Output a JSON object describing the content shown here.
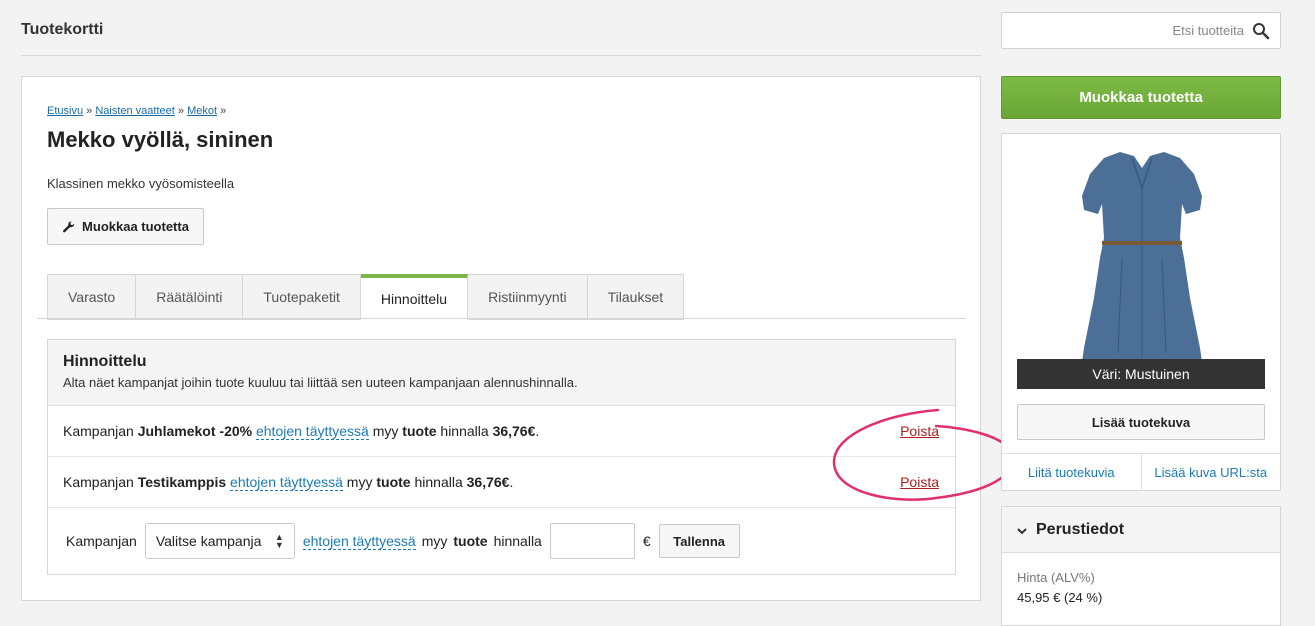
{
  "header": {
    "title": "Tuotekortti",
    "search_placeholder": "Etsi tuotteita"
  },
  "breadcrumb": {
    "items": [
      "Etusivu",
      "Naisten vaatteet",
      "Mekot"
    ],
    "separator": "»"
  },
  "product": {
    "title": "Mekko vyöllä, sininen",
    "description": "Klassinen mekko vyösomisteella",
    "edit_label": "Muokkaa tuotetta"
  },
  "tabs": [
    {
      "label": "Varasto"
    },
    {
      "label": "Räätälöinti"
    },
    {
      "label": "Tuotepaketit"
    },
    {
      "label": "Hinnoittelu",
      "active": true
    },
    {
      "label": "Ristiinmyynti"
    },
    {
      "label": "Tilaukset"
    }
  ],
  "pricing": {
    "title": "Hinnoittelu",
    "subtitle": "Alta näet kampanjat joihin tuote kuuluu tai liittää sen uuteen kampanjaan alennushinnalla.",
    "campaigns": [
      {
        "prefix": "Kampanjan",
        "name": "Juhlamekot -20%",
        "condition": "ehtojen täyttyessä",
        "sells": "myy",
        "object": "tuote",
        "at_price": "hinnalla",
        "price": "36,76€",
        "remove": "Poista"
      },
      {
        "prefix": "Kampanjan",
        "name": "Testikamppis",
        "condition": "ehtojen täyttyessä",
        "sells": "myy",
        "object": "tuote",
        "at_price": "hinnalla",
        "price": "36,76€",
        "remove": "Poista"
      }
    ],
    "new_row": {
      "prefix": "Kampanjan",
      "select_value": "Valitse kampanja",
      "condition": "ehtojen täyttyessä",
      "sells": "myy",
      "object": "tuote",
      "at_price": "hinnalla",
      "currency": "€",
      "save_label": "Tallenna"
    }
  },
  "sidebar": {
    "edit_label": "Muokkaa tuotetta",
    "color_label": "Väri: Mustuinen",
    "add_image_label": "Lisää tuotekuva",
    "attach_images_label": "Liitä tuotekuvia",
    "add_from_url_label": "Lisää kuva URL:sta",
    "basics_title": "Perustiedot",
    "price_label": "Hinta (ALV%)",
    "price_value": "45,95 € (24 %)"
  },
  "colors": {
    "accent_green": "#7ab648",
    "link_blue": "#1a7bb8",
    "remove_red": "#b01e1e",
    "highlight_pink": "#e0306f"
  }
}
